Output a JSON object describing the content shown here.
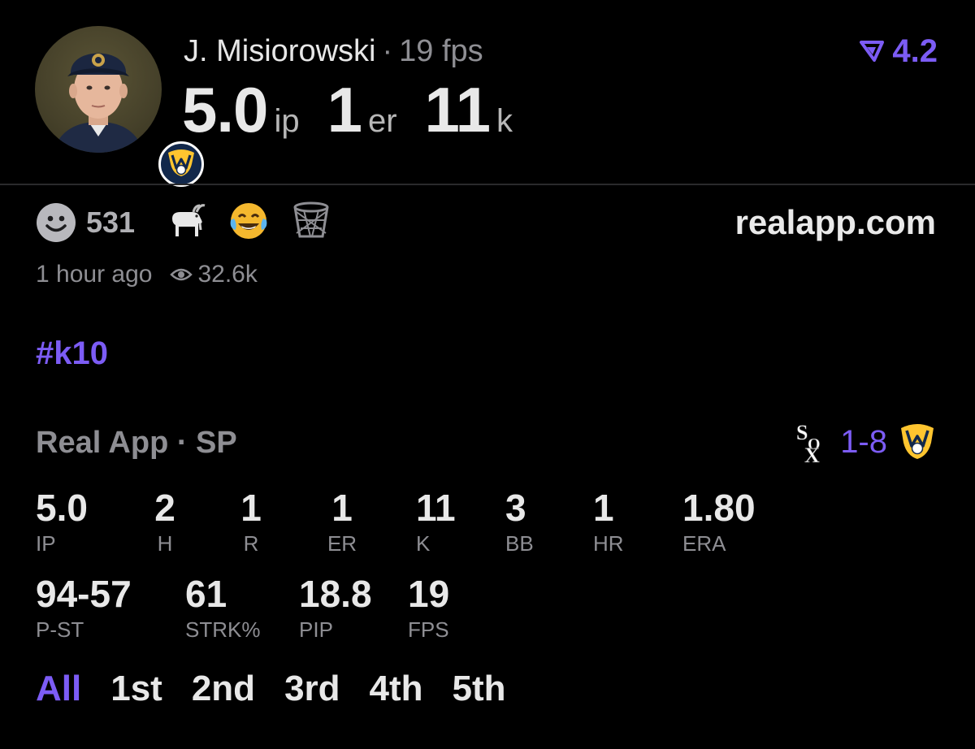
{
  "header": {
    "player_name": "J. Misiorowski",
    "separator": "·",
    "fps_text": "19 fps",
    "ip_value": "5.0",
    "ip_unit": "ip",
    "er_value": "1",
    "er_unit": "er",
    "k_value": "11",
    "k_unit": "k",
    "rating": "4.2",
    "rating_icon": "rating-chevron-icon",
    "team_badge_icon": "brewers-logo-icon"
  },
  "reactions": {
    "count": "531",
    "items": [
      "smiley-face-icon",
      "goat-emoji",
      "laughing-tears-emoji",
      "basketball-net-icon"
    ]
  },
  "site": "realapp.com",
  "meta": {
    "time_ago": "1 hour ago",
    "views": "32.6k"
  },
  "hashtag": "#k10",
  "game": {
    "header": "Real App · SP",
    "score": "1-8",
    "away_logo": "white-sox-logo-icon",
    "home_logo": "brewers-logo-icon"
  },
  "stats_row1": [
    {
      "value": "5.0",
      "label": "IP"
    },
    {
      "value": "2",
      "label": "H"
    },
    {
      "value": "1",
      "label": "R"
    },
    {
      "value": "1",
      "label": "ER"
    },
    {
      "value": "11",
      "label": "K"
    },
    {
      "value": "3",
      "label": "BB"
    },
    {
      "value": "1",
      "label": "HR"
    },
    {
      "value": "1.80",
      "label": "ERA"
    }
  ],
  "stats_row2": [
    {
      "value": "94-57",
      "label": "P-ST"
    },
    {
      "value": "61",
      "label": "STRK%"
    },
    {
      "value": "18.8",
      "label": "PIP"
    },
    {
      "value": "19",
      "label": "FPS"
    }
  ],
  "innings": [
    "All",
    "1st",
    "2nd",
    "3rd",
    "4th",
    "5th"
  ],
  "colors": {
    "accent": "#7c5cf5",
    "background": "#000000",
    "muted": "#8e8e93",
    "brewers_navy": "#12284b",
    "brewers_gold": "#ffc52f"
  }
}
